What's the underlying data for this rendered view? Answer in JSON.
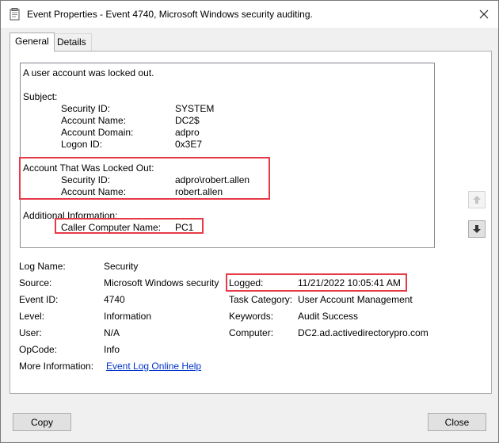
{
  "window": {
    "title": "Event Properties - Event 4740, Microsoft Windows security auditing."
  },
  "tabs": [
    {
      "label": "General",
      "active": true
    },
    {
      "label": "Details",
      "active": false
    }
  ],
  "description": {
    "intro": "A user account was locked out.",
    "subject_heading": "Subject:",
    "subject": [
      {
        "label": "Security ID:",
        "value": "SYSTEM"
      },
      {
        "label": "Account Name:",
        "value": "DC2$"
      },
      {
        "label": "Account Domain:",
        "value": "adpro"
      },
      {
        "label": "Logon ID:",
        "value": "0x3E7"
      }
    ],
    "locked_heading": "Account That Was Locked Out:",
    "locked": [
      {
        "label": "Security ID:",
        "value": "adpro\\robert.allen"
      },
      {
        "label": "Account Name:",
        "value": "robert.allen"
      }
    ],
    "additional_heading": "Additional Information:",
    "caller": {
      "label": "Caller Computer Name:",
      "value": "PC1"
    }
  },
  "details_left": [
    {
      "label": "Log Name:",
      "value": "Security"
    },
    {
      "label": "Source:",
      "value": "Microsoft Windows security"
    },
    {
      "label": "Event ID:",
      "value": "4740"
    },
    {
      "label": "Level:",
      "value": "Information"
    },
    {
      "label": "User:",
      "value": "N/A"
    },
    {
      "label": "OpCode:",
      "value": "Info"
    }
  ],
  "more_info": {
    "label": "More Information:",
    "link": "Event Log Online Help"
  },
  "details_right": [
    {
      "label": "Logged:",
      "value": "11/21/2022 10:05:41 AM"
    },
    {
      "label": "Task Category:",
      "value": "User Account Management"
    },
    {
      "label": "Keywords:",
      "value": "Audit Success"
    },
    {
      "label": "Computer:",
      "value": "DC2.ad.activedirectorypro.com"
    }
  ],
  "buttons": {
    "copy": "Copy",
    "close": "Close"
  },
  "colors": {
    "highlight": "#e63946",
    "link": "#0033cc"
  }
}
